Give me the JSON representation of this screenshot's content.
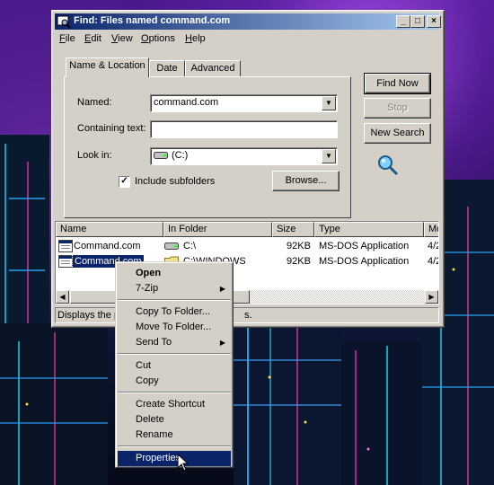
{
  "window": {
    "title": "Find: Files named command.com",
    "controls": {
      "minimize": "_",
      "maximize": "□",
      "close": "×"
    }
  },
  "menubar": {
    "items": [
      {
        "pre": "",
        "key": "F",
        "post": "ile"
      },
      {
        "pre": "",
        "key": "E",
        "post": "dit"
      },
      {
        "pre": "",
        "key": "V",
        "post": "iew"
      },
      {
        "pre": "",
        "key": "O",
        "post": "ptions"
      },
      {
        "pre": "",
        "key": "H",
        "post": "elp"
      }
    ]
  },
  "tabs": [
    "Name & Location",
    "Date",
    "Advanced"
  ],
  "form": {
    "named_label": "Named:",
    "named_value": "command.com",
    "containing_label": "Containing text:",
    "containing_value": "",
    "lookin_label": "Look in:",
    "lookin_value": "(C:)",
    "include_subfolders_label": "Include subfolders",
    "include_subfolders_checked": true,
    "browse_label": "Browse..."
  },
  "buttons": {
    "find_now": "Find Now",
    "stop": "Stop",
    "new_search": "New Search"
  },
  "results": {
    "columns": [
      "Name",
      "In Folder",
      "Size",
      "Type",
      "Mo"
    ],
    "rows": [
      {
        "name": "Command.com",
        "folder": "C:\\",
        "size": "92KB",
        "type": "MS-DOS Application",
        "modified": "4/2"
      },
      {
        "name": "Command.com",
        "folder": "C:\\WINDOWS",
        "size": "92KB",
        "type": "MS-DOS Application",
        "modified": "4/2"
      }
    ]
  },
  "status_bar": {
    "left": "Displays the p",
    "right": "s."
  },
  "context_menu": {
    "items": [
      {
        "label": "Open",
        "bold": true
      },
      {
        "label": "7-Zip",
        "submenu": true
      },
      {
        "label": "Copy To Folder..."
      },
      {
        "label": "Move To Folder..."
      },
      {
        "label": "Send To",
        "submenu": true
      },
      {
        "label": "Cut"
      },
      {
        "label": "Copy"
      },
      {
        "label": "Create Shortcut"
      },
      {
        "label": "Delete"
      },
      {
        "label": "Rename"
      },
      {
        "label": "Properties",
        "highlighted": true
      }
    ]
  },
  "colors": {
    "titlebar_start": "#0a246a",
    "titlebar_end": "#a6caf0",
    "highlight": "#0a246a",
    "face": "#d4d0c8"
  }
}
